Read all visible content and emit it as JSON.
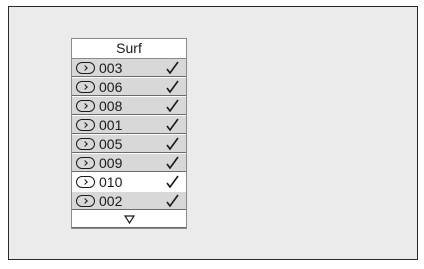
{
  "menu": {
    "title": "Surf",
    "items": [
      {
        "label": "003",
        "checked": true,
        "selected": false
      },
      {
        "label": "006",
        "checked": true,
        "selected": false
      },
      {
        "label": "008",
        "checked": true,
        "selected": false
      },
      {
        "label": "001",
        "checked": true,
        "selected": false
      },
      {
        "label": "005",
        "checked": true,
        "selected": false
      },
      {
        "label": "009",
        "checked": true,
        "selected": false
      },
      {
        "label": "010",
        "checked": true,
        "selected": true
      },
      {
        "label": "002",
        "checked": true,
        "selected": false
      }
    ],
    "item_icon": "right-arrow-button-icon",
    "check_icon": "checkmark-icon",
    "scroll_icon": "down-triangle-icon"
  },
  "colors": {
    "screen_bg": "#ebebeb",
    "item_bg": "#d8d8d8",
    "selected_bg": "#ffffff",
    "text": "#1a1a1a"
  }
}
